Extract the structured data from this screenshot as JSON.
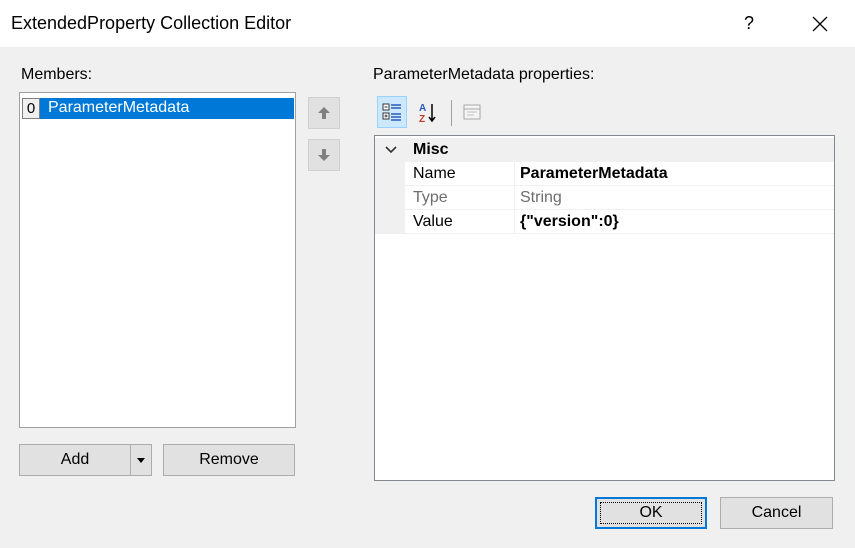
{
  "window": {
    "title": "ExtendedProperty Collection Editor",
    "help_label": "?"
  },
  "members": {
    "label": "Members:",
    "items": [
      {
        "index": "0",
        "name": "ParameterMetadata"
      }
    ],
    "add_label": "Add",
    "remove_label": "Remove"
  },
  "properties": {
    "label": "ParameterMetadata  properties:",
    "category": "Misc",
    "rows": [
      {
        "name": "Name",
        "value": "ParameterMetadata"
      },
      {
        "name": "Type",
        "value": "String"
      },
      {
        "name": "Value",
        "value": "{\"version\":0}"
      }
    ]
  },
  "footer": {
    "ok_label": "OK",
    "cancel_label": "Cancel"
  },
  "colors": {
    "selection": "#0078d7",
    "background": "#f0f0f0",
    "button": "#e1e1e1"
  }
}
